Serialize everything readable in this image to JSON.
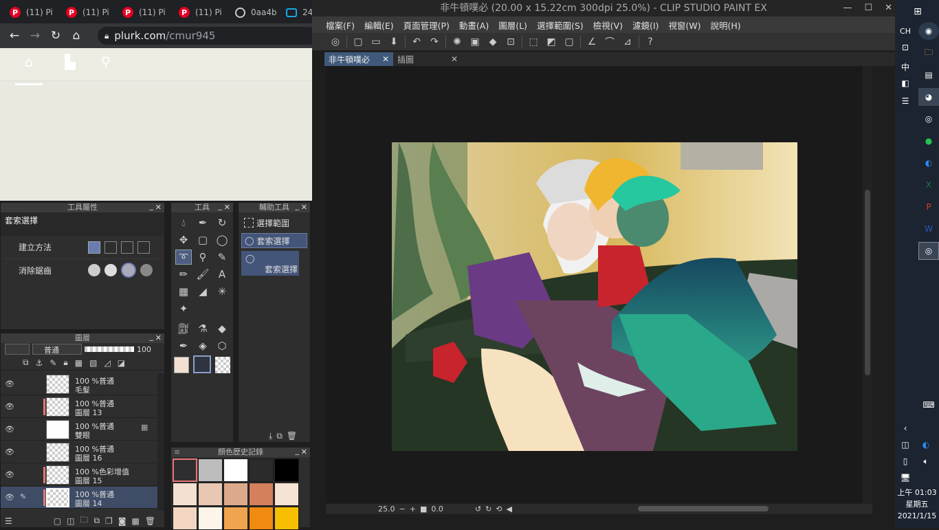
{
  "browser": {
    "tabs": [
      {
        "label": "(11) Pi"
      },
      {
        "label": "(11) Pi"
      },
      {
        "label": "(11) Pi"
      },
      {
        "label": "(11) Pi"
      },
      {
        "label": "0aa4b"
      },
      {
        "label": "24"
      }
    ],
    "url_domain": "plurk.com",
    "url_path": "/cmur945"
  },
  "app": {
    "title": "非牛頓噗必 (20.00 x 15.22cm 300dpi 25.0%)  - CLIP STUDIO PAINT EX",
    "menu": [
      "檔案(F)",
      "編輯(E)",
      "頁面管理(P)",
      "動畫(A)",
      "圖層(L)",
      "選擇範圍(S)",
      "檢視(V)",
      "濾鏡(I)",
      "視窗(W)",
      "說明(H)"
    ],
    "doc_tabs": [
      "非牛頓噗必",
      "插圖"
    ]
  },
  "tool_property": {
    "header": "工具屬性",
    "tool_name": "套索選擇",
    "create_method_label": "建立方法",
    "antialias_label": "消除鋸齒"
  },
  "tools": {
    "header": "工具"
  },
  "sub_tool": {
    "header": "輔助工具",
    "items": [
      "選擇範圍",
      "套索選擇",
      "套索選擇"
    ]
  },
  "layers": {
    "header": "圖層",
    "blend_mode": "普通",
    "opacity": "100",
    "items": [
      {
        "opacity_mode": "100 %普通",
        "name": "毛髮"
      },
      {
        "opacity_mode": "100 %普通",
        "name": "圖層 13"
      },
      {
        "opacity_mode": "100 %普通",
        "name": "雙眼"
      },
      {
        "opacity_mode": "100 %普通",
        "name": "圖層 16"
      },
      {
        "opacity_mode": "100 %色彩增值",
        "name": "圖層 15"
      },
      {
        "opacity_mode": "100 %普通",
        "name": "圖層 14"
      }
    ]
  },
  "color_history": {
    "header": "顏色歷史記錄",
    "colors": [
      "#2e2e30",
      "#bdbdbd",
      "#ffffff",
      "#2b2b2b",
      "#000000",
      "#f3e0d0",
      "#e8c8b2",
      "#dda98c",
      "#d4805d",
      "#f6e2d4",
      "#f3d6c2",
      "#fdf5ea",
      "#f0a450",
      "#f08a10",
      "#f6c000"
    ]
  },
  "status": {
    "zoom": "25.0",
    "rotation": "0.0"
  },
  "taskbar": {
    "lang": "CH",
    "ime": "中",
    "time": "上午 01:03",
    "weekday": "星期五",
    "date": "2021/1/15"
  }
}
